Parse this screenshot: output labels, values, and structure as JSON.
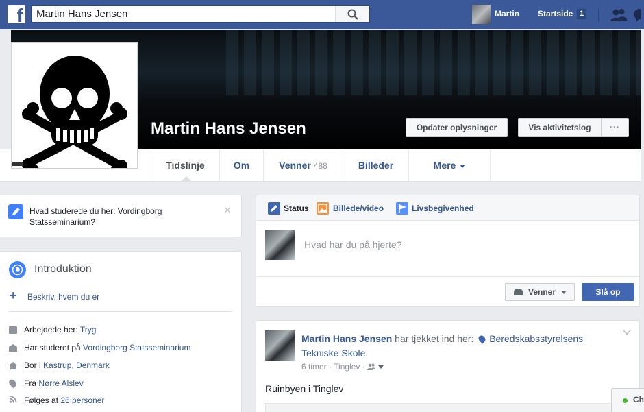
{
  "topbar": {
    "logo": "f",
    "search_value": "Martin Hans Jensen",
    "user_name": "Martin",
    "home_label": "Startside",
    "home_badge": "1",
    "icons": [
      "facebook-logo-icon",
      "search-icon",
      "friend-requests-icon",
      "messages-icon"
    ]
  },
  "profile": {
    "name": "Martin Hans Jensen",
    "update_info_label": "Opdater oplysninger",
    "activity_log_label": "Vis aktivitetslog",
    "more_label": "···"
  },
  "timeline_nav": {
    "tabs": [
      {
        "label": "Tidslinje"
      },
      {
        "label": "Om"
      },
      {
        "label": "Venner",
        "count": "488"
      },
      {
        "label": "Billeder"
      },
      {
        "label": "Mere"
      }
    ]
  },
  "study_prompt": {
    "text": "Hvad studerede du her: Vordingborg Statsseminarium?",
    "close": "×"
  },
  "intro": {
    "title": "Introduktion",
    "describe_label": "Beskriv, hvem du er",
    "rows": [
      {
        "prefix": "Arbejdede her: ",
        "link": "Tryg",
        "suffix": "",
        "icon": "briefcase-icon"
      },
      {
        "prefix": "Har studeret på ",
        "link": "Vordingborg Statsseminarium",
        "suffix": "",
        "icon": "school-icon"
      },
      {
        "prefix": "Bor i ",
        "link": "Kastrup, Denmark",
        "suffix": "",
        "icon": "home-icon"
      },
      {
        "prefix": "Fra ",
        "link": "Nørre Alslev",
        "suffix": "",
        "icon": "location-pin-icon"
      },
      {
        "prefix": "Følges af ",
        "link": "26 personer",
        "suffix": "",
        "icon": "rss-feed-icon"
      }
    ]
  },
  "composer": {
    "tabs": [
      {
        "label": "Status"
      },
      {
        "label": "Billede/video"
      },
      {
        "label": "Livsbegivenhed"
      }
    ],
    "placeholder": "Hvad har du på hjerte?",
    "audience_label": "Venner",
    "post_label": "Slå op"
  },
  "post": {
    "author": "Martin Hans Jensen",
    "checkin_text": " har tjekket ind her: ",
    "place": "Beredskabsstyrelsens Tekniske Skole",
    "place_suffix": ".",
    "time": "6 timer",
    "location": "Tinglev",
    "body": "Ruinbyen i Tinglev"
  },
  "chat": {
    "label": "Ch"
  },
  "colors": {
    "brand": "#3b5998",
    "link": "#365899",
    "primary_button": "#4267b2",
    "background": "#e9ebee",
    "online": "#42b72a"
  }
}
